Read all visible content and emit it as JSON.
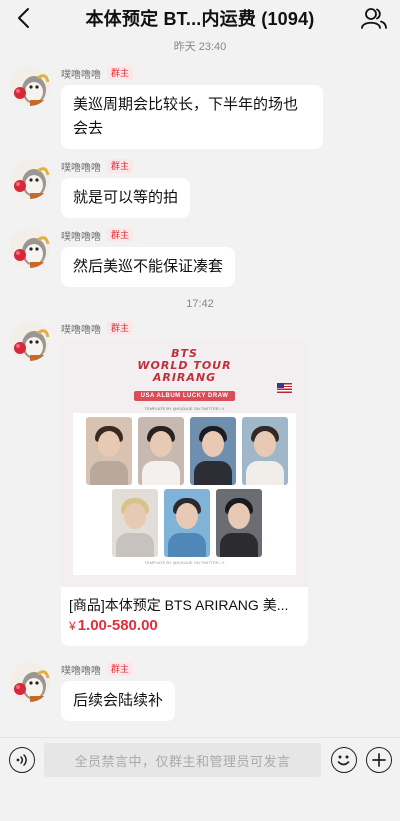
{
  "header": {
    "back_icon": "chevron-left-icon",
    "title": "本体预定 BT...内运费 (1094)",
    "members_icon": "group-members-icon"
  },
  "chat": {
    "time_dividers": [
      "昨天 23:40",
      "17:42"
    ],
    "sender": {
      "name": "噗噜噜噜",
      "role": "群主"
    },
    "messages": [
      {
        "text": "美巡周期会比较长，下半年的场也会去"
      },
      {
        "text": "就是可以等的拍"
      },
      {
        "text": "然后美巡不能保证凑套"
      },
      {
        "text": "后续会陆续补"
      }
    ],
    "product": {
      "poster": {
        "title_line1": "BTS",
        "title_line2": "WORLD TOUR",
        "title_line3": "ARIRANG",
        "subtitle": "USA ALBUM LUCKY DRAW",
        "credit": "TEMPLATE BY @KUDAJE ON TWITTER / X",
        "footer": "TEMPLATE BY @KUDAJE ON TWITTER / X",
        "flag_icon": "usa-flag-icon"
      },
      "title": "[商品]本体预定 BTS ARIRANG 美...",
      "price_symbol": "¥",
      "price": "1.00-580.00"
    }
  },
  "bottom": {
    "voice_icon": "voice-icon",
    "input_placeholder": "全员禁言中，仅群主和管理员可发言",
    "emoji_icon": "emoji-icon",
    "plus_icon": "plus-icon"
  },
  "colors": {
    "accent_red": "#e0303a",
    "badge_bg": "#fde6e7",
    "background": "#f2f2f2"
  }
}
